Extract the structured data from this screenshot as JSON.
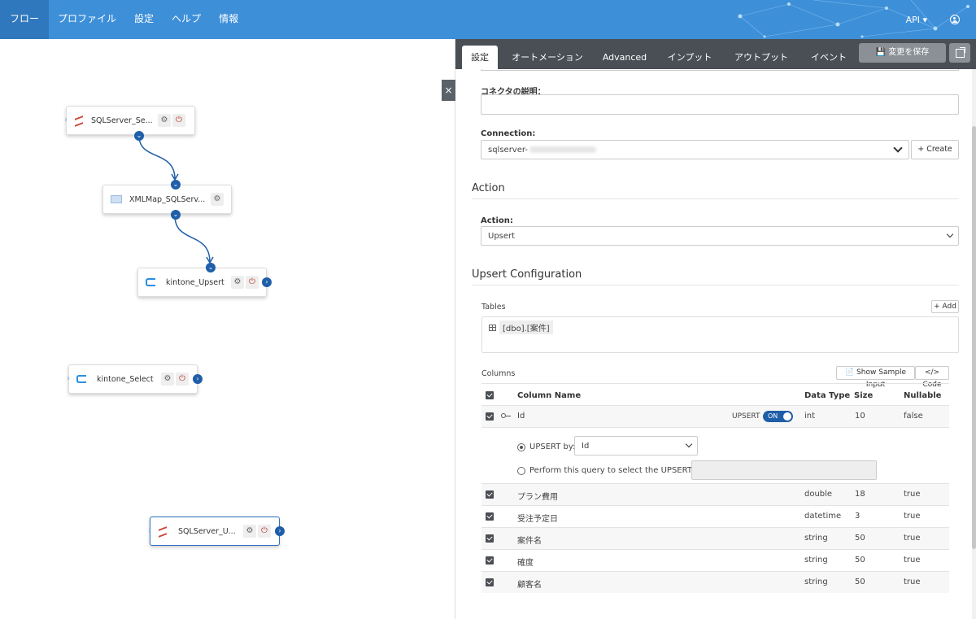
{
  "nav": {
    "items": [
      "フロー",
      "プロファイル",
      "設定",
      "ヘルプ",
      "情報"
    ],
    "api_label": "API ▾"
  },
  "canvas": {
    "nodes": [
      {
        "label": "SQLServer_Se...",
        "icon": "sqlserver-icon"
      },
      {
        "label": "XMLMap_SQLServ...",
        "icon": "xmlmap-icon"
      },
      {
        "label": "kintone_Upsert",
        "icon": "kintone-icon"
      },
      {
        "label": "kintone_Select",
        "icon": "kintone-icon"
      },
      {
        "label": "SQLServer_U...",
        "icon": "sqlserver-icon"
      }
    ],
    "connector_color": "#1f5ea8"
  },
  "panel": {
    "tabs": [
      "設定",
      "オートメーション",
      "Advanced",
      "インプット",
      "アウトプット",
      "イベント"
    ],
    "save_label": "変更を保存",
    "desc_label": "コネクタの説明：",
    "connection_label": "Connection:",
    "connection_value": "sqlserver-",
    "create_label": "+ Create",
    "action_section": "Action",
    "action_label": "Action:",
    "action_value": "Upsert",
    "upsert_section": "Upsert Configuration",
    "tables_label": "Tables",
    "add_label": "+ Add",
    "table_name": "[dbo].[案件]",
    "columns_label": "Columns",
    "show_sample_label": "Show Sample Input",
    "code_label": "</> Code",
    "headers": {
      "name": "Column Name",
      "type": "Data Type",
      "size": "Size",
      "nullable": "Nullable"
    },
    "id_row": {
      "name": "Id",
      "upsert": "UPSERT",
      "toggle": "ON",
      "type": "int",
      "size": "10",
      "nullable": "false"
    },
    "upsert_by_label": "UPSERT by:",
    "upsert_by_value": "Id",
    "query_label": "Perform this query to select the UPSERT key:",
    "rows": [
      {
        "name": "プラン費用",
        "type": "double",
        "size": "18",
        "nullable": "true"
      },
      {
        "name": "受注予定日",
        "type": "datetime",
        "size": "3",
        "nullable": "true"
      },
      {
        "name": "案件名",
        "type": "string",
        "size": "50",
        "nullable": "true"
      },
      {
        "name": "確度",
        "type": "string",
        "size": "50",
        "nullable": "true"
      },
      {
        "name": "顧客名",
        "type": "string",
        "size": "50",
        "nullable": "true"
      }
    ]
  },
  "colors": {
    "topbar": "#3d8fd8",
    "accent": "#1f5ea8",
    "tabbar": "#4a4f55"
  }
}
